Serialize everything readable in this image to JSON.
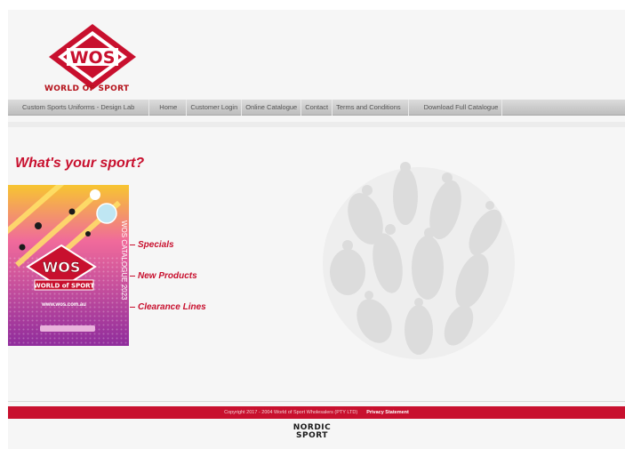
{
  "header": {
    "logo_letters": "WOS",
    "logo_caption": "WORLD OF SPORT",
    "brand_color": "#c8102e"
  },
  "nav": {
    "items": [
      "Custom Sports Uniforms - Design Lab",
      "Home",
      "Customer Login",
      "Online Catalogue",
      "Contact",
      "Terms and Conditions",
      "Download Full Catalogue"
    ]
  },
  "main": {
    "heading": "What's your sport?",
    "catalogue": {
      "brand": "WOS",
      "brand_sub": "WORLD of SPORT",
      "side_title": "WOS CATALOGUE 2023",
      "url": "www.wos.com.au"
    },
    "links": [
      "Specials",
      "New Products",
      "Clearance Lines"
    ]
  },
  "footer": {
    "copyright": "Copyright 2017 - 2004 World of Sport Wholesalers (PTY LTD)",
    "privacy": "Privacy Statement",
    "partner_line1": "NORDIC",
    "partner_line2": "SPORT"
  }
}
